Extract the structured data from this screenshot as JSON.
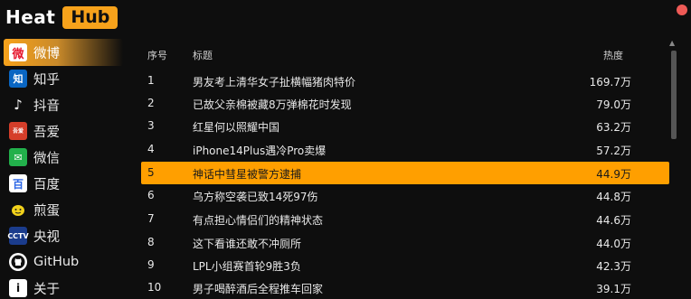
{
  "app": {
    "logo_part1": "Heat",
    "logo_part2": "Hub"
  },
  "sidebar": {
    "items": [
      {
        "label": "微博",
        "icon": "weibo-icon",
        "glyph": "微",
        "active": true
      },
      {
        "label": "知乎",
        "icon": "zhihu-icon",
        "glyph": "知"
      },
      {
        "label": "抖音",
        "icon": "douyin-icon",
        "glyph": "♪"
      },
      {
        "label": "吾爱",
        "icon": "52pojie-icon",
        "glyph": "吾爱"
      },
      {
        "label": "微信",
        "icon": "wechat-icon",
        "glyph": "✉"
      },
      {
        "label": "百度",
        "icon": "baidu-icon",
        "glyph": "百"
      },
      {
        "label": "煎蛋",
        "icon": "jandan-icon",
        "glyph": "●"
      },
      {
        "label": "央视",
        "icon": "cctv-icon",
        "glyph": "CCTV"
      },
      {
        "label": "GitHub",
        "icon": "github-icon",
        "glyph": "◉"
      },
      {
        "label": "关于",
        "icon": "about-icon",
        "glyph": "i"
      }
    ]
  },
  "table": {
    "headers": {
      "rank": "序号",
      "title": "标题",
      "heat": "热度"
    },
    "rows": [
      {
        "rank": "1",
        "title": "男友考上清华女子扯横幅猪肉特价",
        "heat": "169.7万"
      },
      {
        "rank": "2",
        "title": "已故父亲棉被藏8万弹棉花时发现",
        "heat": "79.0万"
      },
      {
        "rank": "3",
        "title": "红星何以照耀中国",
        "heat": "63.2万"
      },
      {
        "rank": "4",
        "title": "iPhone14Plus遇冷Pro卖爆",
        "heat": "57.2万"
      },
      {
        "rank": "5",
        "title": "神话中彗星被警方逮捕",
        "heat": "44.9万",
        "highlighted": true
      },
      {
        "rank": "6",
        "title": "乌方称空袭已致14死97伤",
        "heat": "44.8万"
      },
      {
        "rank": "7",
        "title": "有点担心情侣们的精神状态",
        "heat": "44.6万"
      },
      {
        "rank": "8",
        "title": "这下看谁还敢不冲厕所",
        "heat": "44.0万"
      },
      {
        "rank": "9",
        "title": "LPL小组赛首轮9胜3负",
        "heat": "42.3万"
      },
      {
        "rank": "10",
        "title": "男子喝醉酒后全程推车回家",
        "heat": "39.1万"
      }
    ]
  },
  "colors": {
    "accent": "#f7a21b",
    "highlight_row": "#ff9f00",
    "close": "#ee5a56",
    "background": "#0e0e0e"
  }
}
